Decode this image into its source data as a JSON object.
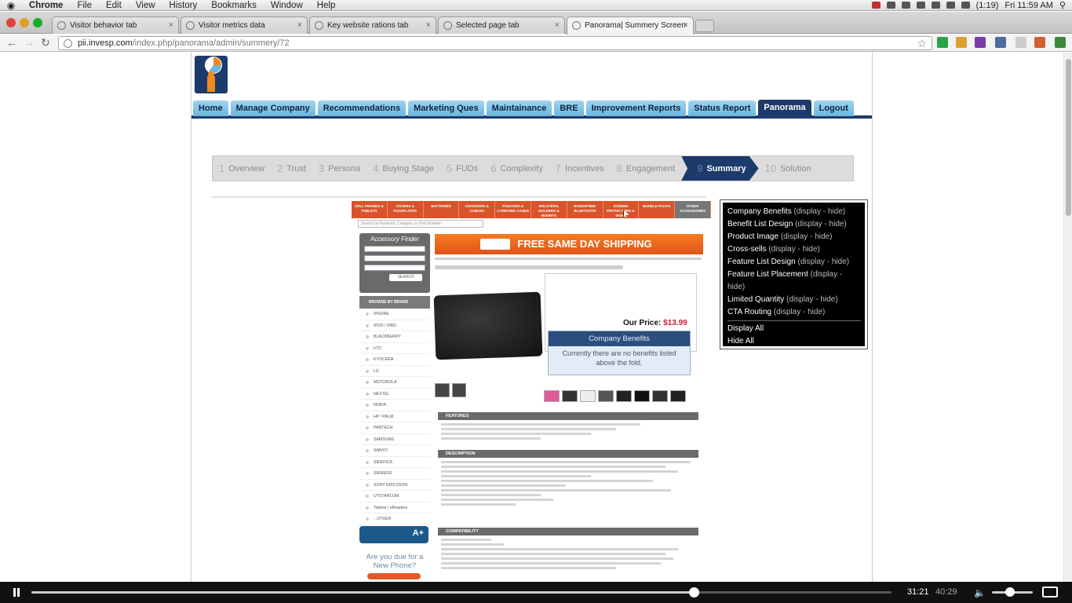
{
  "menubar": {
    "app": "Chrome",
    "items": [
      "File",
      "Edit",
      "View",
      "History",
      "Bookmarks",
      "Window",
      "Help"
    ],
    "battery": "(1:19)",
    "clock": "Fri 11:59 AM"
  },
  "tabs": [
    {
      "label": "Visitor behavior tab"
    },
    {
      "label": "Visitor metrics data"
    },
    {
      "label": "Key website rations tab"
    },
    {
      "label": "Selected page tab"
    },
    {
      "label": "Panorama| Summery Screen"
    }
  ],
  "address": {
    "host": "pii.invesp.com",
    "path": "/index.php/panorama/admin/summery/72"
  },
  "nav": [
    {
      "label": "Home"
    },
    {
      "label": "Manage Company"
    },
    {
      "label": "Recommendations"
    },
    {
      "label": "Marketing Ques"
    },
    {
      "label": "Maintainance"
    },
    {
      "label": "BRE"
    },
    {
      "label": "Improvement Reports"
    },
    {
      "label": "Status Report"
    },
    {
      "label": "Panorama"
    },
    {
      "label": "Logout"
    }
  ],
  "steps": [
    {
      "num": "1",
      "label": "Overview"
    },
    {
      "num": "2",
      "label": "Trust"
    },
    {
      "num": "3",
      "label": "Persona"
    },
    {
      "num": "4",
      "label": "Buying Stage"
    },
    {
      "num": "5",
      "label": "FUDs"
    },
    {
      "num": "6",
      "label": "Complexity"
    },
    {
      "num": "7",
      "label": "Incentives"
    },
    {
      "num": "8",
      "label": "Engagement"
    },
    {
      "num": "9",
      "label": "Summary"
    },
    {
      "num": "10",
      "label": "Solution"
    }
  ],
  "screenshot": {
    "categories": [
      "CELL PHONES & TABLETS",
      "COVERS & FACEPLATES",
      "BATTERIES",
      "CHARGERS & CABLES",
      "POUCHES & CARRYING CASES",
      "HOLSTERS, HOLDERS & MOUNTS",
      "HANDSFREE BLUETOOTH",
      "SCREEN PROTECTORS & SKINS",
      "BUNDLE PACKS",
      "OTHER ACCESSORIES"
    ],
    "search_placeholder": "Search by Keyword, Category or Part Number",
    "finder_title": "Accessory Finder",
    "finder_search": "SEARCH",
    "browse_by_brand": "BROWSE BY BRAND",
    "brands": [
      "IPHONE",
      "IPOD / IPAD",
      "BLACKBERRY",
      "HTC",
      "KYOCERA",
      "LG",
      "MOTOROLA",
      "NEXTEL",
      "NOKIA",
      "HP / PALM",
      "PANTECH",
      "SAMSUNG",
      "SANYO",
      "SIDEKICK",
      "SIEMENS",
      "SONY ERICSSON",
      "UTSTARCOM",
      "Tablets / eReaders",
      "...OTHER"
    ],
    "bbb_grade": "A+",
    "due_text": "Are you due for a New Phone?",
    "shipping_banner": "FREE SAME DAY SHIPPING",
    "our_price_label": "Our Price:",
    "our_price_value": "$13.99",
    "features_label": "FEATURES",
    "description_label": "DESCRIPTION",
    "compatibility_label": "COMPATIBILITY",
    "popup_title": "Company Benefits",
    "popup_body": "Currently there are no benefits listed above the fold."
  },
  "panel": {
    "items": [
      {
        "label": "Company Benefits"
      },
      {
        "label": "Benefit List Design"
      },
      {
        "label": "Product Image"
      },
      {
        "label": "Cross-sells"
      },
      {
        "label": "Feature List Design"
      },
      {
        "label": "Feature List Placement"
      },
      {
        "label": "Limited Quantity"
      },
      {
        "label": "CTA Routing"
      }
    ],
    "display_label": "display",
    "hide_label": "hide",
    "display_all": "Display All",
    "hide_all": "Hide All"
  },
  "player": {
    "current": "31:21",
    "total": "40:29",
    "progress": 0.7741,
    "volume": 0.35
  }
}
